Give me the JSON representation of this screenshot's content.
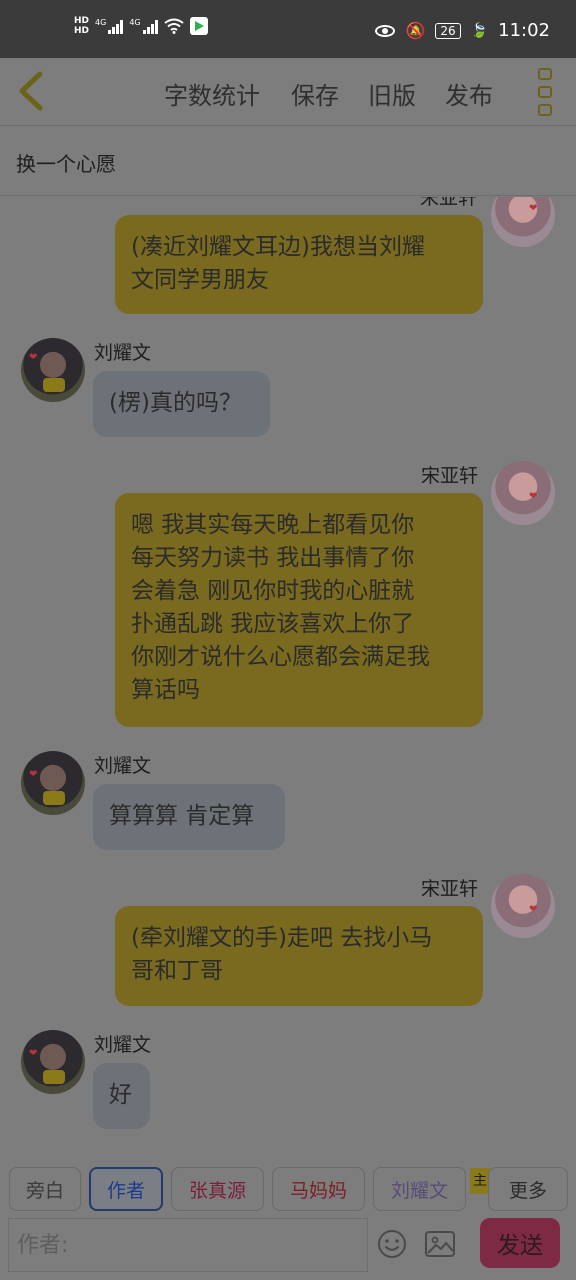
{
  "status_bar": {
    "hd1": "HD",
    "hd2": "HD",
    "net1": "4G",
    "net2": "4G",
    "battery": "26",
    "time": "11:02"
  },
  "toolbar": {
    "word_count": "字数统计",
    "save": "保存",
    "old_version": "旧版",
    "publish": "发布"
  },
  "wish": {
    "label": "换一个心愿"
  },
  "messages": [
    {
      "side": "right",
      "name": "宋亚轩",
      "lines": [
        "(凑近刘耀文耳边)我想当刘耀",
        "文同学男朋友"
      ]
    },
    {
      "side": "left",
      "name": "刘耀文",
      "lines": [
        "(楞)真的吗？"
      ]
    },
    {
      "side": "right",
      "name": "宋亚轩",
      "lines": [
        "嗯 我其实每天晚上都看见你",
        "每天努力读书 我出事情了你",
        "会着急 刚见你时我的心脏就",
        "扑通乱跳 我应该喜欢上你了",
        "你刚才说什么心愿都会满足我",
        "算话吗"
      ]
    },
    {
      "side": "left",
      "name": "刘耀文",
      "lines": [
        "算算算 肯定算"
      ]
    },
    {
      "side": "right",
      "name": "宋亚轩",
      "lines": [
        "(牵刘耀文的手)走吧 去找小马",
        "哥和丁哥"
      ]
    },
    {
      "side": "left",
      "name": "刘耀文",
      "lines": [
        "好"
      ]
    }
  ],
  "roles": {
    "narration": "旁白",
    "author": "作者",
    "zhang": "张真源",
    "ma_mama": "马妈妈",
    "liu": "刘耀文",
    "main_tag": "主",
    "more": "更多"
  },
  "colors": {
    "narration": "#4a4a4a",
    "author": "#1f3a8a",
    "zhang": "#7a1f3a",
    "ma_mama": "#7a1f2a",
    "liu": "#5a4a7a"
  },
  "input": {
    "placeholder": "作者:",
    "send": "发送"
  },
  "icons": {
    "back": "chevron-left-icon",
    "menu": "more-vertical-icon",
    "emoji": "smiley-icon",
    "image": "image-icon"
  }
}
